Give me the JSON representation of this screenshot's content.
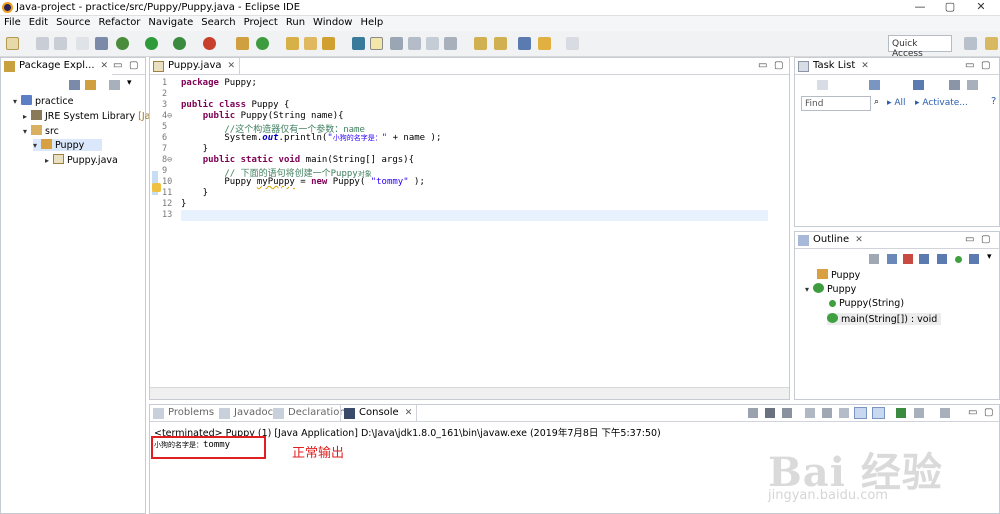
{
  "window": {
    "title": "Java-project - practice/src/Puppy/Puppy.java - Eclipse IDE",
    "minimize": "—",
    "maximize": "▢",
    "close": "✕"
  },
  "menu": [
    "File",
    "Edit",
    "Source",
    "Refactor",
    "Navigate",
    "Search",
    "Project",
    "Run",
    "Window",
    "Help"
  ],
  "toolbar": {
    "quick_access": "Quick Access"
  },
  "package_explorer": {
    "tab": "Package Expl...",
    "items": [
      {
        "label": "practice",
        "level": 0,
        "arrow": "▾"
      },
      {
        "label": "JRE System Library",
        "suffix": "[Jav",
        "level": 1,
        "arrow": "▸"
      },
      {
        "label": "src",
        "level": 1,
        "arrow": "▾"
      },
      {
        "label": "Puppy",
        "level": 2,
        "arrow": "▾"
      },
      {
        "label": "Puppy.java",
        "level": 3,
        "arrow": "▸"
      }
    ]
  },
  "editor": {
    "tab": "Puppy.java",
    "line_numbers": [
      "1",
      "2",
      "3",
      "4⊖",
      "5",
      "6",
      "7",
      "8⊖",
      "9",
      "10",
      "11",
      "12",
      "13"
    ]
  },
  "task_list": {
    "tab": "Task List",
    "find_placeholder": "Find",
    "all": "All",
    "activate": "Activate..."
  },
  "outline": {
    "tab": "Outline",
    "items": [
      {
        "label": "Puppy",
        "level": 0
      },
      {
        "label": "Puppy",
        "level": 0
      },
      {
        "label": "Puppy(String)",
        "level": 1
      },
      {
        "label": "main(String[]) : void",
        "level": 1
      }
    ]
  },
  "bottom_tabs": {
    "problems": "Problems",
    "javadoc": "Javadoc",
    "declaration": "Declaration",
    "console": "Console"
  },
  "console": {
    "description": "<terminated> Puppy (1) [Java Application] D:\\Java\\jdk1.8.0_161\\bin\\javaw.exe (2019年7月8日 下午5:37:50)",
    "output_prefix": "小狗的名字是：",
    "output_value": "tommy"
  },
  "annotation": "正常输出",
  "watermark": {
    "main": "Bai 经验",
    "sub": "jingyan.baidu.com"
  },
  "colors": {
    "annotation_red": "#e02020",
    "keyword": "#7f0055",
    "comment": "#3f7f5f",
    "string": "#2a00ff"
  }
}
